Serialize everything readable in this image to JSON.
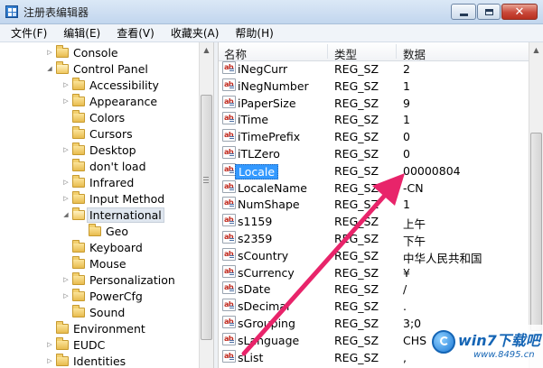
{
  "window": {
    "title": "注册表编辑器",
    "controls": {
      "minimize": "minimize-icon",
      "maximize": "maximize-icon",
      "close": "✕"
    }
  },
  "menu": [
    "文件(F)",
    "编辑(E)",
    "查看(V)",
    "收藏夹(A)",
    "帮助(H)"
  ],
  "tree": {
    "items": [
      {
        "label": "Console",
        "level": 1,
        "expander": "▷"
      },
      {
        "label": "Control Panel",
        "level": 1,
        "expander": "◢",
        "open": true
      },
      {
        "label": "Accessibility",
        "level": 2,
        "expander": "▷"
      },
      {
        "label": "Appearance",
        "level": 2,
        "expander": "▷"
      },
      {
        "label": "Colors",
        "level": 2,
        "expander": ""
      },
      {
        "label": "Cursors",
        "level": 2,
        "expander": ""
      },
      {
        "label": "Desktop",
        "level": 2,
        "expander": "▷"
      },
      {
        "label": "don't load",
        "level": 2,
        "expander": ""
      },
      {
        "label": "Infrared",
        "level": 2,
        "expander": "▷"
      },
      {
        "label": "Input Method",
        "level": 2,
        "expander": "▷"
      },
      {
        "label": "International",
        "level": 2,
        "expander": "◢",
        "open": true,
        "selected": true
      },
      {
        "label": "Geo",
        "level": 3,
        "expander": ""
      },
      {
        "label": "Keyboard",
        "level": 2,
        "expander": ""
      },
      {
        "label": "Mouse",
        "level": 2,
        "expander": ""
      },
      {
        "label": "Personalization",
        "level": 2,
        "expander": "▷"
      },
      {
        "label": "PowerCfg",
        "level": 2,
        "expander": "▷"
      },
      {
        "label": "Sound",
        "level": 2,
        "expander": ""
      },
      {
        "label": "Environment",
        "level": 1,
        "expander": ""
      },
      {
        "label": "EUDC",
        "level": 1,
        "expander": "▷"
      },
      {
        "label": "Identities",
        "level": 1,
        "expander": "▷"
      }
    ]
  },
  "list": {
    "columns": [
      "名称",
      "类型",
      "数据"
    ],
    "icon_text": "ab",
    "rows": [
      {
        "name": "iNegCurr",
        "type": "REG_SZ",
        "data": "2"
      },
      {
        "name": "iNegNumber",
        "type": "REG_SZ",
        "data": "1"
      },
      {
        "name": "iPaperSize",
        "type": "REG_SZ",
        "data": "9"
      },
      {
        "name": "iTime",
        "type": "REG_SZ",
        "data": "1"
      },
      {
        "name": "iTimePrefix",
        "type": "REG_SZ",
        "data": "0"
      },
      {
        "name": "iTLZero",
        "type": "REG_SZ",
        "data": "0"
      },
      {
        "name": "Locale",
        "type": "REG_SZ",
        "data": "00000804",
        "selected": true
      },
      {
        "name": "LocaleName",
        "type": "REG_SZ",
        "data": "-CN"
      },
      {
        "name": "NumShape",
        "type": "REG_SZ",
        "data": "1"
      },
      {
        "name": "s1159",
        "type": "REG_SZ",
        "data": "上午"
      },
      {
        "name": "s2359",
        "type": "REG_SZ",
        "data": "下午"
      },
      {
        "name": "sCountry",
        "type": "REG_SZ",
        "data": "中华人民共和国"
      },
      {
        "name": "sCurrency",
        "type": "REG_SZ",
        "data": "¥"
      },
      {
        "name": "sDate",
        "type": "REG_SZ",
        "data": "/"
      },
      {
        "name": "sDecimal",
        "type": "REG_SZ",
        "data": "."
      },
      {
        "name": "sGrouping",
        "type": "REG_SZ",
        "data": "3;0"
      },
      {
        "name": "sLanguage",
        "type": "REG_SZ",
        "data": "CHS"
      },
      {
        "name": "sList",
        "type": "REG_SZ",
        "data": ","
      }
    ]
  },
  "annotation": {
    "color": "#e8246a"
  },
  "watermark": {
    "brand": "win7下载吧",
    "url": "www.8495.cn"
  }
}
